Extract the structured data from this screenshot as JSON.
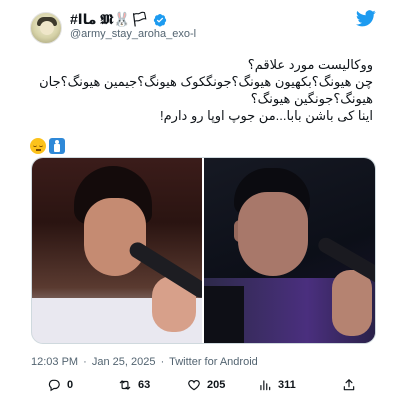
{
  "user": {
    "display_name": "#ماا 𝕸🐰🏳",
    "handle": "@army_stay_aroha_exo-l",
    "verified": true
  },
  "tweet": {
    "lines": [
      "ووکالیست مورد علاقم؟",
      "چن هیونگ؟بکهیون هیونگ؟جونگکوک هیونگ؟جیمین هیونگ؟جان",
      "هیونگ؟جونگین هیونگ؟",
      "اینا کی باشن بابا...من جوپ اوپا رو دارم!"
    ],
    "emojis": [
      "pensive-face",
      "restroom-sign"
    ]
  },
  "media": {
    "photos": [
      "singer-left-photo",
      "singer-right-photo"
    ]
  },
  "meta": {
    "time": "12:03 PM",
    "separator1": "·",
    "date": "Jan 25, 2025",
    "separator2": "·",
    "client": "Twitter for Android"
  },
  "actions": {
    "replies": "0",
    "retweets": "63",
    "likes": "205",
    "views": "311"
  },
  "colors": {
    "brand_blue": "#1d9bf0",
    "text": "#0f1419",
    "muted": "#536471"
  }
}
